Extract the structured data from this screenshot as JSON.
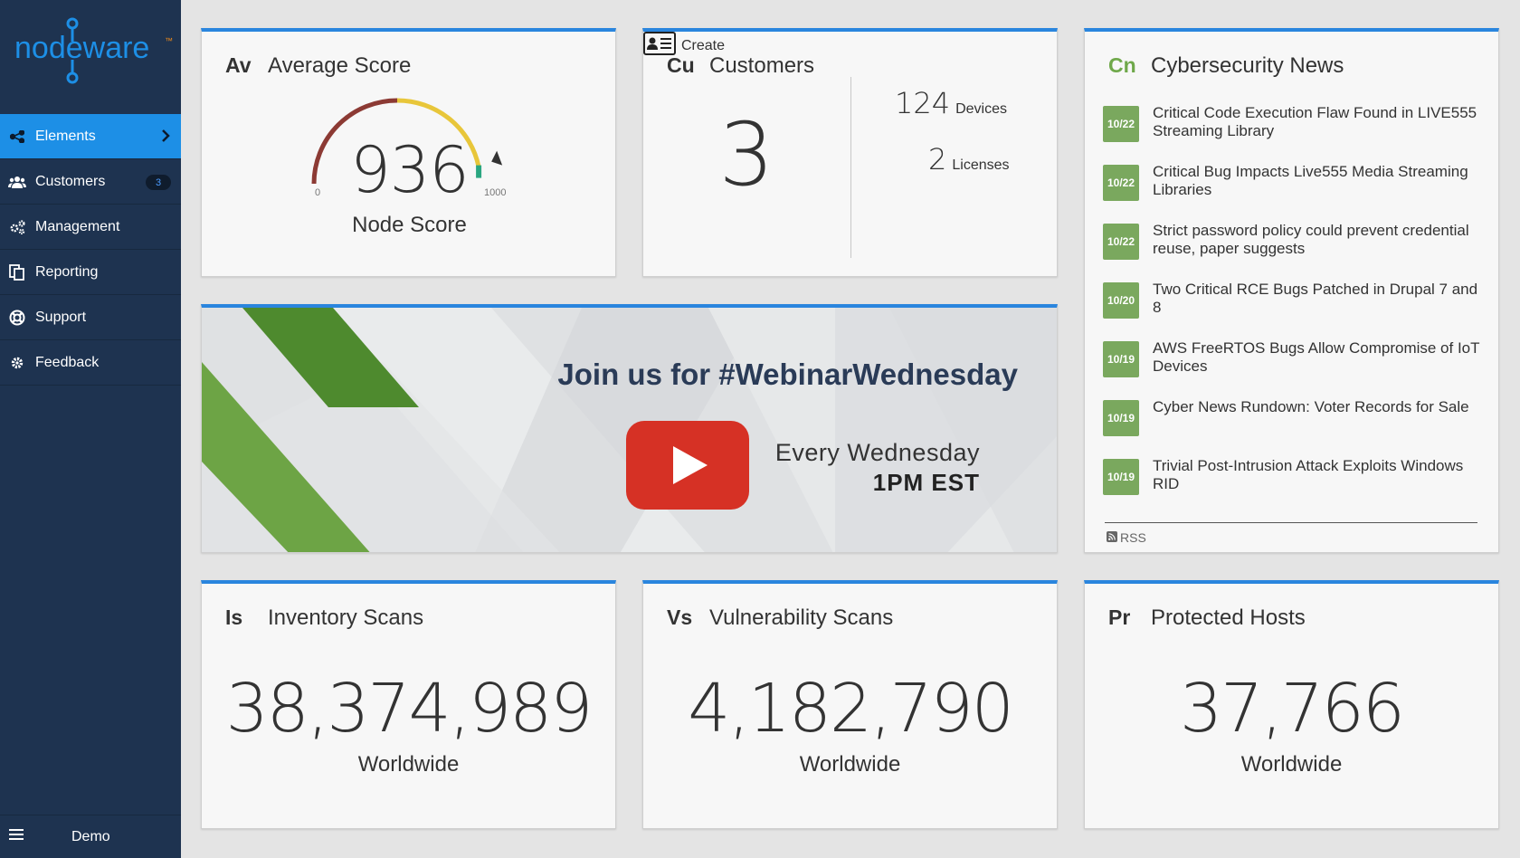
{
  "sidebar": {
    "logo": "nodeware",
    "logo_tm": "™",
    "items": [
      {
        "label": "Elements"
      },
      {
        "label": "Customers",
        "badge": "3"
      },
      {
        "label": "Management"
      },
      {
        "label": "Reporting"
      },
      {
        "label": "Support"
      },
      {
        "label": "Feedback"
      }
    ],
    "footer_label": "Demo"
  },
  "colors": {
    "accent": "#1d8fe6",
    "sidebar": "#1e3350",
    "news_date": "#7aa85e"
  },
  "average_score": {
    "abbr": "Av",
    "title": "Average Score",
    "value": "936",
    "min": "0",
    "max": "1000",
    "label": "Node Score",
    "fraction": 0.936
  },
  "customers": {
    "abbr": "Cu",
    "title": "Customers",
    "count": "3",
    "devices_num": "124",
    "devices_label": "Devices",
    "licenses_num": "2",
    "licenses_label": "Licenses",
    "create_label": "Create"
  },
  "news": {
    "abbr": "Cn",
    "title": "Cybersecurity News",
    "items": [
      {
        "date": "10/22",
        "title": "Critical Code Execution Flaw Found in LIVE555 Streaming Library"
      },
      {
        "date": "10/22",
        "title": "Critical Bug Impacts Live555 Media Streaming Libraries"
      },
      {
        "date": "10/22",
        "title": "Strict password policy could prevent credential reuse, paper suggests"
      },
      {
        "date": "10/20",
        "title": "Two Critical RCE Bugs Patched in Drupal 7 and 8"
      },
      {
        "date": "10/19",
        "title": "AWS FreeRTOS Bugs Allow Compromise of IoT Devices"
      },
      {
        "date": "10/19",
        "title": "Cyber News Rundown: Voter Records for Sale"
      },
      {
        "date": "10/19",
        "title": "Trivial Post-Intrusion Attack Exploits Windows RID"
      }
    ],
    "rss_label": "RSS"
  },
  "webinar": {
    "heading": "Join us for #WebinarWednesday",
    "day": "Every Wednesday",
    "time": "1PM EST"
  },
  "inventory": {
    "abbr": "Is",
    "title": "Inventory Scans",
    "value": "38,374,989",
    "sub": "Worldwide"
  },
  "vulnerability": {
    "abbr": "Vs",
    "title": "Vulnerability Scans",
    "value": "4,182,790",
    "sub": "Worldwide"
  },
  "hosts": {
    "abbr": "Pr",
    "title": "Protected Hosts",
    "value": "37,766",
    "sub": "Worldwide"
  }
}
